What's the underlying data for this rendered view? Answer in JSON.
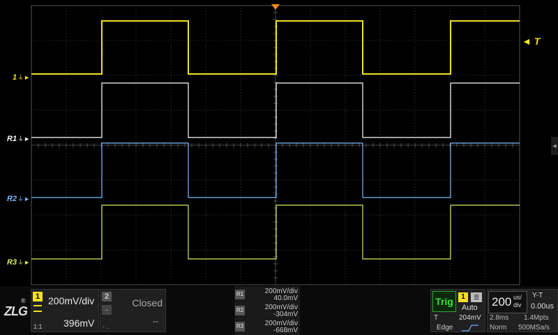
{
  "channels": {
    "ch1": {
      "label": "1",
      "color": "#f0e020"
    },
    "r1": {
      "label": "R1",
      "color": "#ffffff"
    },
    "r2": {
      "label": "R2",
      "color": "#7ab8ff"
    },
    "r3": {
      "label": "R3",
      "color": "#d8ec60"
    }
  },
  "trigger_marker": {
    "label": "T"
  },
  "bottom_bar": {
    "logo": "ZLG",
    "logo_mark": "®",
    "ch1_panel": {
      "number": "1",
      "scale": "200mV/div",
      "offset": "396mV",
      "coupling": "1:1"
    },
    "ch2_panel": {
      "number": "2",
      "state": "Closed",
      "offset": "--",
      "coupling": "- .."
    },
    "refs": [
      {
        "label": "R1",
        "scale": "200mV/div",
        "offset": "40.0mV"
      },
      {
        "label": "R2",
        "scale": "200mV/div",
        "offset": "-304mV"
      },
      {
        "label": "R3",
        "scale": "200mV/div",
        "offset": "-668mV"
      }
    ],
    "trigger_panel": {
      "title": "Trig",
      "source": "1",
      "mode": "Auto",
      "level_label": "T",
      "level": "204mV",
      "type": "Edge"
    },
    "timebase_panel": {
      "value": "200",
      "unit_top": "us/",
      "unit_bottom": "div",
      "mode": "Y-T",
      "offset": "0.00us",
      "window": "2.8ms",
      "depth": "1.4Mpts",
      "acq": "Norm",
      "rate": "500MSa/s"
    }
  },
  "colors": {
    "ch1": "#f0e020",
    "r1": "#ffffff",
    "r2": "#7ab8ff",
    "r3": "#d8ec60",
    "grid": "#3a3a3a",
    "trigger": "#f08a1a"
  }
}
